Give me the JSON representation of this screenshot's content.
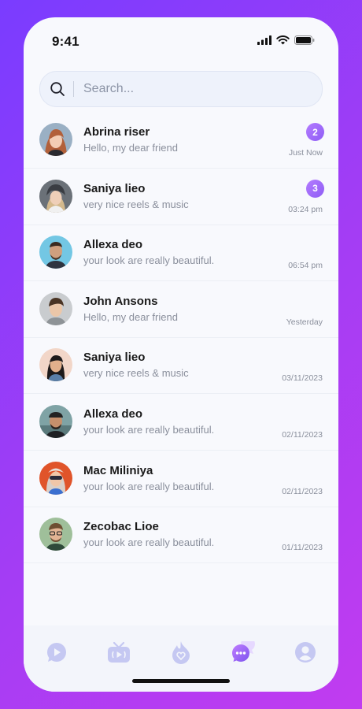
{
  "status": {
    "time": "9:41"
  },
  "search": {
    "placeholder": "Search..."
  },
  "chats": [
    {
      "name": "Abrina riser",
      "message": "Hello, my dear friend",
      "timestamp": "Just Now",
      "unread": "2"
    },
    {
      "name": "Saniya lieo",
      "message": "very nice reels & music",
      "timestamp": "03:24 pm",
      "unread": "3"
    },
    {
      "name": "Allexa deo",
      "message": "your look are really beautiful.",
      "timestamp": "06:54 pm"
    },
    {
      "name": "John Ansons",
      "message": "Hello, my dear friend",
      "timestamp": "Yesterday"
    },
    {
      "name": "Saniya lieo",
      "message": "very nice reels & music",
      "timestamp": "03/11/2023"
    },
    {
      "name": "Allexa deo",
      "message": "your look are really beautiful.",
      "timestamp": "02/11/2023"
    },
    {
      "name": "Mac Miliniya",
      "message": "your look are really beautiful.",
      "timestamp": "02/11/2023"
    },
    {
      "name": "Zecobac Lioe",
      "message": "your look are really beautiful.",
      "timestamp": "01/11/2023"
    }
  ],
  "tabs": [
    {
      "icon": "play-chat-icon"
    },
    {
      "icon": "tv-icon"
    },
    {
      "icon": "flame-heart-icon"
    },
    {
      "icon": "messages-icon",
      "active": true
    },
    {
      "icon": "profile-icon"
    }
  ],
  "colors": {
    "accent": "#9b6cf7",
    "tab_inactive": "#c5c8f2",
    "background_gradient": [
      "#7a3cff",
      "#c13cf0"
    ]
  }
}
